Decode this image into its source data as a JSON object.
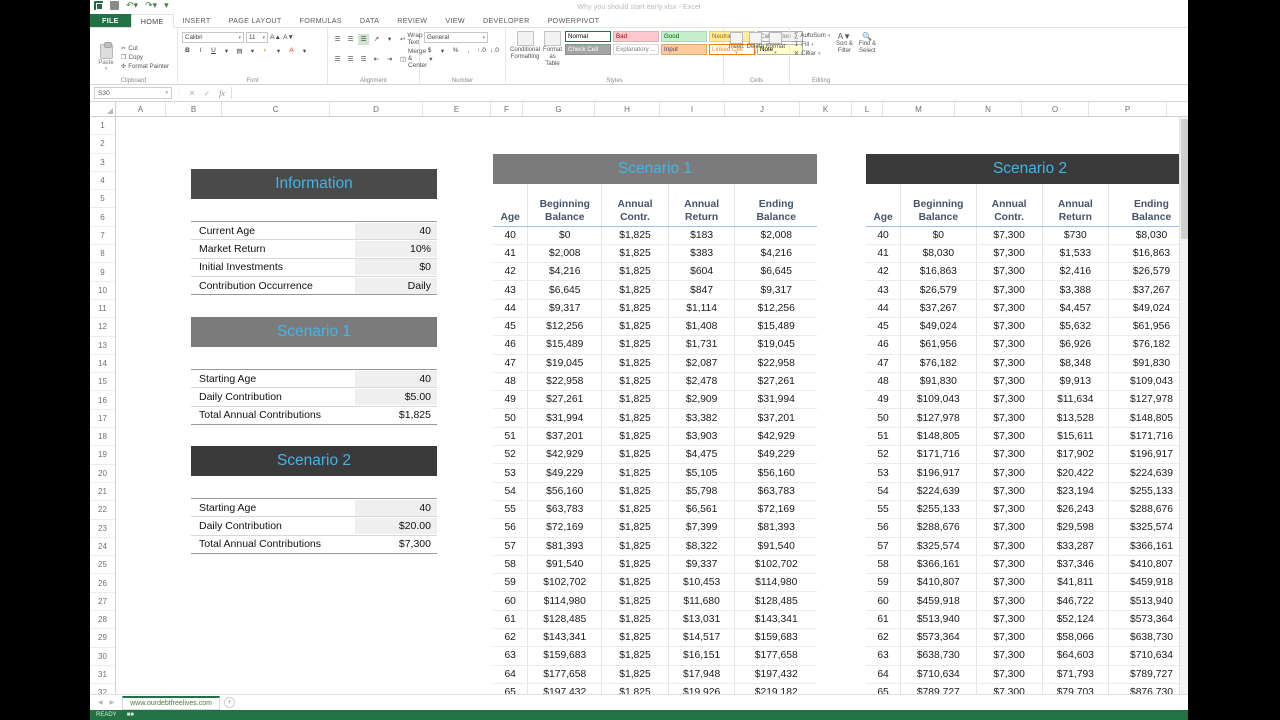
{
  "window": {
    "title": "Why you should start early.xlsx - Excel",
    "quick_access": [
      "excel-icon",
      "save-icon",
      "undo-icon",
      "redo-icon",
      "customize-icon"
    ]
  },
  "ribbon": {
    "tabs": [
      "FILE",
      "HOME",
      "INSERT",
      "PAGE LAYOUT",
      "FORMULAS",
      "DATA",
      "REVIEW",
      "VIEW",
      "DEVELOPER",
      "POWERPIVOT"
    ],
    "active_tab": "HOME",
    "groups": {
      "clipboard": {
        "name": "Clipboard",
        "paste_label": "Paste",
        "items": [
          "Cut",
          "Copy",
          "Format Painter"
        ]
      },
      "font": {
        "name": "Font",
        "font_name": "Calibri",
        "font_size": "11",
        "buttons": [
          "B",
          "I",
          "U",
          "A",
          "A"
        ]
      },
      "alignment": {
        "name": "Alignment",
        "wrap_text": "Wrap Text",
        "merge_center": "Merge & Center"
      },
      "number": {
        "name": "Number",
        "format": "General"
      },
      "styles": {
        "name": "Styles",
        "conditional_formatting": "Conditional Formatting",
        "format_as_table": "Format as Table",
        "cell_styles": [
          {
            "label": "Normal",
            "bg": "#ffffff",
            "fg": "#000000",
            "border": "#217346"
          },
          {
            "label": "Bad",
            "bg": "#ffc7ce",
            "fg": "#9c0006",
            "border": "#e3b0b5"
          },
          {
            "label": "Good",
            "bg": "#c6efce",
            "fg": "#006100",
            "border": "#a8d6b0"
          },
          {
            "label": "Neutral",
            "bg": "#ffeb9c",
            "fg": "#9c6500",
            "border": "#e3cf8a"
          },
          {
            "label": "Calculation",
            "bg": "#f2f2f2",
            "fg": "#7f7f7f",
            "border": "#b0b0b0"
          },
          {
            "label": "Check Cell",
            "bg": "#a5a5a5",
            "fg": "#ffffff",
            "border": "#8f8f8f"
          },
          {
            "label": "Explanatory ...",
            "bg": "#ffffff",
            "fg": "#7f7f7f",
            "border": "#d9d9d9"
          },
          {
            "label": "Input",
            "bg": "#ffcc99",
            "fg": "#3f3f76",
            "border": "#e0a86e"
          },
          {
            "label": "Linked Cell",
            "bg": "#ffffff",
            "fg": "#fa7d00",
            "border": "#fa7d00"
          },
          {
            "label": "Note",
            "bg": "#ffffcc",
            "fg": "#000000",
            "border": "#b2b2b2"
          }
        ]
      },
      "cells": {
        "name": "Cells",
        "buttons": [
          "Insert",
          "Delete",
          "Format"
        ]
      },
      "editing": {
        "name": "Editing",
        "items": [
          "AutoSum",
          "Fill",
          "Clear",
          "Sort & Filter",
          "Find & Select"
        ]
      }
    }
  },
  "formula_bar": {
    "name_box": "S30",
    "formula": "",
    "cancel_icon": "close-icon",
    "confirm_icon": "check-icon",
    "function_icon": "fx-icon"
  },
  "grid": {
    "column_headers": [
      "A",
      "B",
      "C",
      "D",
      "E",
      "F",
      "G",
      "H",
      "I",
      "J",
      "K",
      "L",
      "M",
      "N",
      "O",
      "P"
    ],
    "row_headers": [
      "1",
      "2",
      "3",
      "4",
      "5",
      "6",
      "7",
      "8",
      "9",
      "10",
      "11",
      "12",
      "13",
      "14",
      "15",
      "16",
      "17",
      "18",
      "19",
      "20",
      "21",
      "22",
      "23",
      "24",
      "25",
      "26",
      "27",
      "28",
      "29",
      "30",
      "31",
      "32"
    ]
  },
  "information_panel": {
    "title": "Information",
    "rows": [
      {
        "label": "Current Age",
        "value": "40"
      },
      {
        "label": "Market Return",
        "value": "10%"
      },
      {
        "label": "Initial Investments",
        "value": "$0"
      },
      {
        "label": "Contribution Occurrence",
        "value": "Daily"
      }
    ]
  },
  "scenario1_panel": {
    "title": "Scenario 1",
    "rows": [
      {
        "label": "Starting Age",
        "value": "40"
      },
      {
        "label": "Daily Contribution",
        "value": "$5.00"
      },
      {
        "label": "Total Annual Contributions",
        "value": "$1,825"
      }
    ]
  },
  "scenario2_panel": {
    "title": "Scenario 2",
    "rows": [
      {
        "label": "Starting Age",
        "value": "40"
      },
      {
        "label": "Daily Contribution",
        "value": "$20.00"
      },
      {
        "label": "Total Annual Contributions",
        "value": "$7,300"
      }
    ]
  },
  "scenario1_table": {
    "title": "Scenario 1",
    "columns": [
      "Age",
      "Beginning Balance",
      "Annual Contr.",
      "Annual Return",
      "Ending Balance"
    ],
    "rows": [
      [
        "40",
        "$0",
        "$1,825",
        "$183",
        "$2,008"
      ],
      [
        "41",
        "$2,008",
        "$1,825",
        "$383",
        "$4,216"
      ],
      [
        "42",
        "$4,216",
        "$1,825",
        "$604",
        "$6,645"
      ],
      [
        "43",
        "$6,645",
        "$1,825",
        "$847",
        "$9,317"
      ],
      [
        "44",
        "$9,317",
        "$1,825",
        "$1,114",
        "$12,256"
      ],
      [
        "45",
        "$12,256",
        "$1,825",
        "$1,408",
        "$15,489"
      ],
      [
        "46",
        "$15,489",
        "$1,825",
        "$1,731",
        "$19,045"
      ],
      [
        "47",
        "$19,045",
        "$1,825",
        "$2,087",
        "$22,958"
      ],
      [
        "48",
        "$22,958",
        "$1,825",
        "$2,478",
        "$27,261"
      ],
      [
        "49",
        "$27,261",
        "$1,825",
        "$2,909",
        "$31,994"
      ],
      [
        "50",
        "$31,994",
        "$1,825",
        "$3,382",
        "$37,201"
      ],
      [
        "51",
        "$37,201",
        "$1,825",
        "$3,903",
        "$42,929"
      ],
      [
        "52",
        "$42,929",
        "$1,825",
        "$4,475",
        "$49,229"
      ],
      [
        "53",
        "$49,229",
        "$1,825",
        "$5,105",
        "$56,160"
      ],
      [
        "54",
        "$56,160",
        "$1,825",
        "$5,798",
        "$63,783"
      ],
      [
        "55",
        "$63,783",
        "$1,825",
        "$6,561",
        "$72,169"
      ],
      [
        "56",
        "$72,169",
        "$1,825",
        "$7,399",
        "$81,393"
      ],
      [
        "57",
        "$81,393",
        "$1,825",
        "$8,322",
        "$91,540"
      ],
      [
        "58",
        "$91,540",
        "$1,825",
        "$9,337",
        "$102,702"
      ],
      [
        "59",
        "$102,702",
        "$1,825",
        "$10,453",
        "$114,980"
      ],
      [
        "60",
        "$114,980",
        "$1,825",
        "$11,680",
        "$128,485"
      ],
      [
        "61",
        "$128,485",
        "$1,825",
        "$13,031",
        "$143,341"
      ],
      [
        "62",
        "$143,341",
        "$1,825",
        "$14,517",
        "$159,683"
      ],
      [
        "63",
        "$159,683",
        "$1,825",
        "$16,151",
        "$177,658"
      ],
      [
        "64",
        "$177,658",
        "$1,825",
        "$17,948",
        "$197,432"
      ],
      [
        "65",
        "$197,432",
        "$1,825",
        "$19,926",
        "$219,182"
      ]
    ]
  },
  "scenario2_table": {
    "title": "Scenario 2",
    "columns": [
      "Age",
      "Beginning Balance",
      "Annual Contr.",
      "Annual Return",
      "Ending Balance"
    ],
    "rows": [
      [
        "40",
        "$0",
        "$7,300",
        "$730",
        "$8,030"
      ],
      [
        "41",
        "$8,030",
        "$7,300",
        "$1,533",
        "$16,863"
      ],
      [
        "42",
        "$16,863",
        "$7,300",
        "$2,416",
        "$26,579"
      ],
      [
        "43",
        "$26,579",
        "$7,300",
        "$3,388",
        "$37,267"
      ],
      [
        "44",
        "$37,267",
        "$7,300",
        "$4,457",
        "$49,024"
      ],
      [
        "45",
        "$49,024",
        "$7,300",
        "$5,632",
        "$61,956"
      ],
      [
        "46",
        "$61,956",
        "$7,300",
        "$6,926",
        "$76,182"
      ],
      [
        "47",
        "$76,182",
        "$7,300",
        "$8,348",
        "$91,830"
      ],
      [
        "48",
        "$91,830",
        "$7,300",
        "$9,913",
        "$109,043"
      ],
      [
        "49",
        "$109,043",
        "$7,300",
        "$11,634",
        "$127,978"
      ],
      [
        "50",
        "$127,978",
        "$7,300",
        "$13,528",
        "$148,805"
      ],
      [
        "51",
        "$148,805",
        "$7,300",
        "$15,611",
        "$171,716"
      ],
      [
        "52",
        "$171,716",
        "$7,300",
        "$17,902",
        "$196,917"
      ],
      [
        "53",
        "$196,917",
        "$7,300",
        "$20,422",
        "$224,639"
      ],
      [
        "54",
        "$224,639",
        "$7,300",
        "$23,194",
        "$255,133"
      ],
      [
        "55",
        "$255,133",
        "$7,300",
        "$26,243",
        "$288,676"
      ],
      [
        "56",
        "$288,676",
        "$7,300",
        "$29,598",
        "$325,574"
      ],
      [
        "57",
        "$325,574",
        "$7,300",
        "$33,287",
        "$366,161"
      ],
      [
        "58",
        "$366,161",
        "$7,300",
        "$37,346",
        "$410,807"
      ],
      [
        "59",
        "$410,807",
        "$7,300",
        "$41,811",
        "$459,918"
      ],
      [
        "60",
        "$459,918",
        "$7,300",
        "$46,722",
        "$513,940"
      ],
      [
        "61",
        "$513,940",
        "$7,300",
        "$52,124",
        "$573,364"
      ],
      [
        "62",
        "$573,364",
        "$7,300",
        "$58,066",
        "$638,730"
      ],
      [
        "63",
        "$638,730",
        "$7,300",
        "$64,603",
        "$710,634"
      ],
      [
        "64",
        "$710,634",
        "$7,300",
        "$71,793",
        "$789,727"
      ],
      [
        "65",
        "$789,727",
        "$7,300",
        "$79,703",
        "$876,730"
      ]
    ]
  },
  "sheet_tabs": {
    "tabs": [
      "www.ourdebtfreelives.com"
    ],
    "active": "www.ourdebtfreelives.com",
    "add_label": "+"
  },
  "status_bar": {
    "mode": "READY",
    "accent": "#217346"
  },
  "colors": {
    "header_accent": "#41b6e6",
    "panel_dark": "#4a4a4a",
    "panel_mid": "#7b7b7b",
    "panel_darker": "#3a3a3a",
    "table_header_text": "#44546a",
    "excel_green": "#217346"
  }
}
